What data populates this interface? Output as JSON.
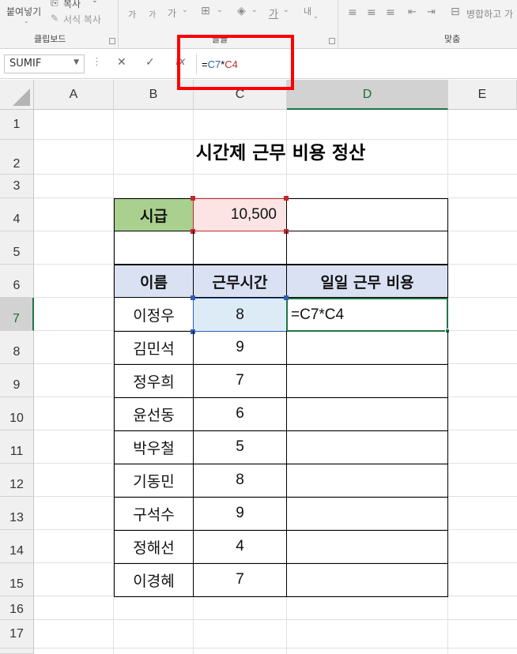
{
  "ribbon": {
    "paste_label": "붙여넣기",
    "copy_label": "복사",
    "format_painter_label": "서식 복사",
    "clipboard_group": "클립보드",
    "font_group": "글꼴",
    "align_group": "맞춤",
    "merge_label": "병합하고 가",
    "font_grow_icon": "가",
    "font_shrink_icon": "가",
    "font_color_icon": "가",
    "wrap_icon": "내"
  },
  "formula_bar": {
    "name_box": "SUMIF",
    "formula_prefix": "=",
    "formula_ref1": "C7",
    "formula_op": "*",
    "formula_ref2": "C4",
    "ref1_color": "#2e5fb3",
    "ref2_color": "#c0282e"
  },
  "columns": [
    "A",
    "B",
    "C",
    "D",
    "E"
  ],
  "rows": [
    "1",
    "2",
    "3",
    "4",
    "5",
    "6",
    "7",
    "8",
    "9",
    "10",
    "11",
    "12",
    "13",
    "14",
    "15",
    "16",
    "17"
  ],
  "sheet": {
    "title": "시간제 근무 비용 정산",
    "wage_label": "시급",
    "wage_value": "10,500",
    "headers": [
      "이름",
      "근무시간",
      "일일 근무 비용"
    ],
    "employees": [
      {
        "name": "이정우",
        "hours": "8"
      },
      {
        "name": "김민석",
        "hours": "9"
      },
      {
        "name": "정우희",
        "hours": "7"
      },
      {
        "name": "윤선동",
        "hours": "6"
      },
      {
        "name": "박우철",
        "hours": "5"
      },
      {
        "name": "기동민",
        "hours": "8"
      },
      {
        "name": "구석수",
        "hours": "9"
      },
      {
        "name": "정해선",
        "hours": "4"
      },
      {
        "name": "이경혜",
        "hours": "7"
      }
    ],
    "editing_cell_text": "=C7*C4",
    "colors": {
      "wage_label_bg": "#a9d08e",
      "wage_value_bg": "#fce4e4",
      "header_bg": "#d9e1f2",
      "active_hours_bg": "#ddebf7"
    }
  }
}
